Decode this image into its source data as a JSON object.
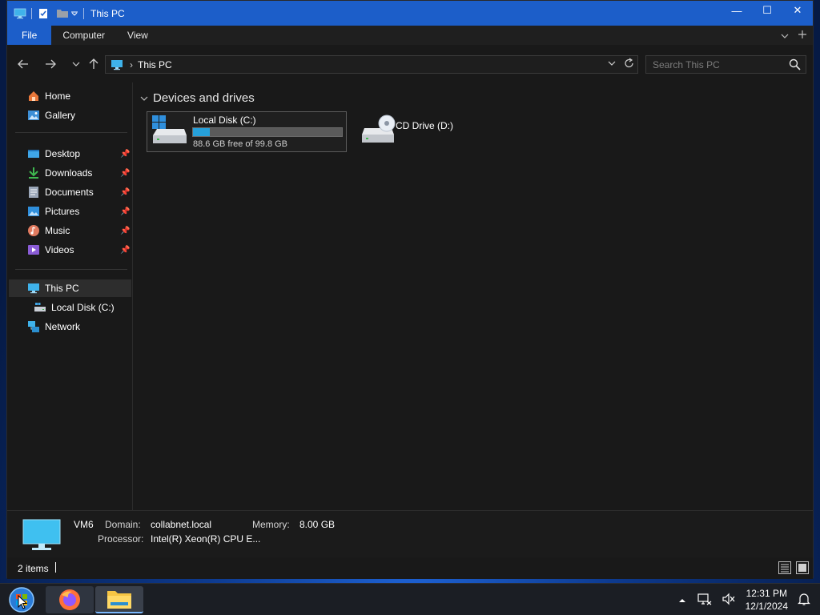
{
  "window": {
    "title": "This PC",
    "controls": {
      "minimize": "—",
      "maximize": "☐",
      "close": "✕"
    }
  },
  "ribbon": {
    "tabs": [
      {
        "label": "File",
        "active": true
      },
      {
        "label": "Computer",
        "active": false
      },
      {
        "label": "View",
        "active": false
      }
    ]
  },
  "address": {
    "path": "This PC",
    "search_placeholder": "Search This PC"
  },
  "sidebar": {
    "quick": [
      {
        "label": "Home",
        "icon": "home-icon"
      },
      {
        "label": "Gallery",
        "icon": "gallery-icon"
      }
    ],
    "pinned": [
      {
        "label": "Desktop",
        "icon": "desktop-icon"
      },
      {
        "label": "Downloads",
        "icon": "downloads-icon"
      },
      {
        "label": "Documents",
        "icon": "documents-icon"
      },
      {
        "label": "Pictures",
        "icon": "pictures-icon"
      },
      {
        "label": "Music",
        "icon": "music-icon"
      },
      {
        "label": "Videos",
        "icon": "videos-icon"
      }
    ],
    "tree": [
      {
        "label": "This PC",
        "icon": "computer-icon",
        "selected": true
      },
      {
        "label": "Local Disk (C:)",
        "icon": "drive-icon"
      },
      {
        "label": "Network",
        "icon": "network-icon"
      }
    ]
  },
  "content": {
    "group_title": "Devices and drives",
    "drives": [
      {
        "name": "Local Disk (C:)",
        "free_text": "88.6 GB free of 99.8 GB",
        "used_fraction": 0.112
      },
      {
        "name": "CD Drive (D:)"
      }
    ]
  },
  "details": {
    "computer_name": "VM6",
    "domain_label": "Domain:",
    "domain_value": "collabnet.local",
    "memory_label": "Memory:",
    "memory_value": "8.00 GB",
    "processor_label": "Processor:",
    "processor_value": "Intel(R) Xeon(R) CPU E..."
  },
  "status": {
    "item_count": "2 items"
  },
  "taskbar": {
    "apps": [
      "start-button",
      "firefox",
      "file-explorer"
    ],
    "time": "12:31 PM",
    "date": "12/1/2024"
  },
  "colors": {
    "accent": "#1c5ec9",
    "progress": "#26a0da",
    "window_bg": "#191919"
  }
}
